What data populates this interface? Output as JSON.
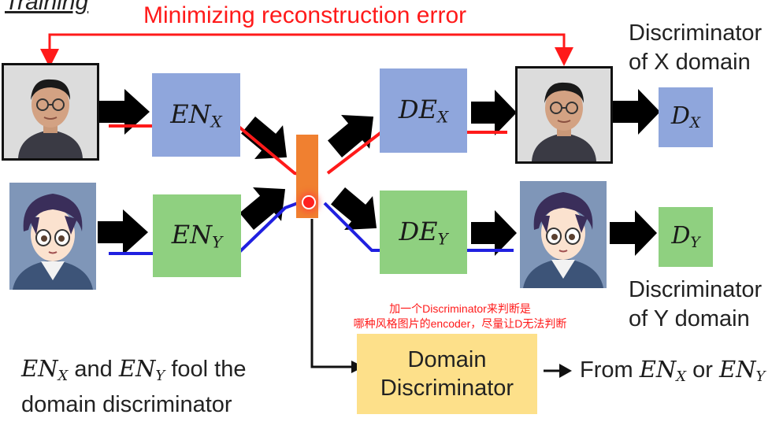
{
  "header": {
    "section_title": "Training"
  },
  "reconstruction_label": "Minimizing reconstruction error",
  "encoders": {
    "x": {
      "base": "EN",
      "sub": "X"
    },
    "y": {
      "base": "EN",
      "sub": "Y"
    }
  },
  "decoders": {
    "x": {
      "base": "DE",
      "sub": "X"
    },
    "y": {
      "base": "DE",
      "sub": "Y"
    }
  },
  "discriminators": {
    "x": {
      "base": "D",
      "sub": "X",
      "caption_line1": "Discriminator",
      "caption_line2": "of X domain"
    },
    "y": {
      "base": "D",
      "sub": "Y",
      "caption_line1": "Discriminator",
      "caption_line2": "of Y domain"
    }
  },
  "annotation": {
    "line1": "加一个Discriminator来判断是",
    "line2": "哪种风格图片的encoder，尽量让D无法判断"
  },
  "domain_discriminator": {
    "line1": "Domain",
    "line2": "Discriminator"
  },
  "output_text": {
    "prefix": "From ",
    "a_base": "EN",
    "a_sub": "X",
    "middle": " or ",
    "b_base": "EN",
    "b_sub": "Y"
  },
  "bottom_left": {
    "a_base": "EN",
    "a_sub": "X",
    "mid": " and ",
    "b_base": "EN",
    "b_sub": "Y",
    "tail": " fool the",
    "line2": "domain discriminator"
  },
  "colors": {
    "red": "#ff1a1a",
    "blue": "#2020e0",
    "encoder_x": "#8fa6dc",
    "encoder_y": "#8fd080",
    "latent": "#f08030",
    "domain_box": "#fde08a"
  }
}
